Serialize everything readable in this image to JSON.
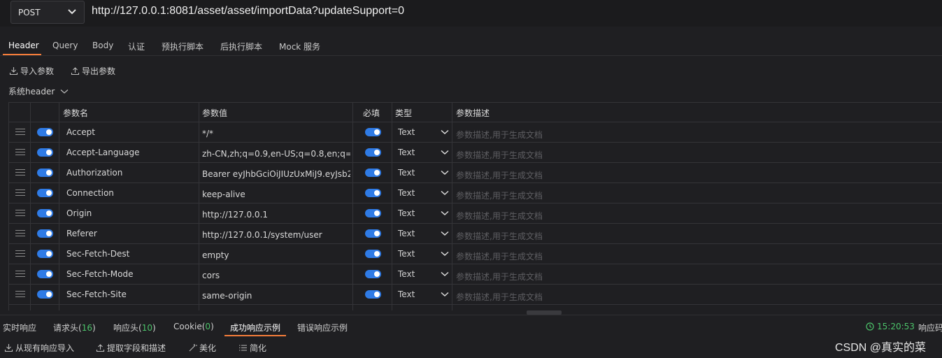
{
  "request": {
    "method": "POST",
    "url": "http://127.0.0.1:8081/asset/asset/importData?updateSupport=0"
  },
  "tabs": [
    "Header",
    "Query",
    "Body",
    "认证",
    "预执行脚本",
    "后执行脚本",
    "Mock 服务"
  ],
  "toolbar": {
    "import_label": "导入参数",
    "export_label": "导出参数",
    "system_header_label": "系统header"
  },
  "table": {
    "columns": {
      "name": "参数名",
      "value": "参数值",
      "required": "必填",
      "type": "类型",
      "description": "参数描述"
    },
    "rows": [
      {
        "name": "Accept",
        "value": "*/*",
        "type": "Text",
        "desc_placeholder": "参数描述,用于生成文档",
        "enabled": true,
        "required": true
      },
      {
        "name": "Accept-Language",
        "value": "zh-CN,zh;q=0.9,en-US;q=0.8,en;q=0.",
        "type": "Text",
        "desc_placeholder": "参数描述,用于生成文档",
        "enabled": true,
        "required": true
      },
      {
        "name": "Authorization",
        "value": "Bearer eyJhbGciOiJIUzUxMiJ9.eyJsb2",
        "type": "Text",
        "desc_placeholder": "参数描述,用于生成文档",
        "enabled": true,
        "required": true
      },
      {
        "name": "Connection",
        "value": "keep-alive",
        "type": "Text",
        "desc_placeholder": "参数描述,用于生成文档",
        "enabled": true,
        "required": true
      },
      {
        "name": "Origin",
        "value": "http://127.0.0.1",
        "type": "Text",
        "desc_placeholder": "参数描述,用于生成文档",
        "enabled": true,
        "required": true
      },
      {
        "name": "Referer",
        "value": "http://127.0.0.1/system/user",
        "type": "Text",
        "desc_placeholder": "参数描述,用于生成文档",
        "enabled": true,
        "required": true
      },
      {
        "name": "Sec-Fetch-Dest",
        "value": "empty",
        "type": "Text",
        "desc_placeholder": "参数描述,用于生成文档",
        "enabled": true,
        "required": true
      },
      {
        "name": "Sec-Fetch-Mode",
        "value": "cors",
        "type": "Text",
        "desc_placeholder": "参数描述,用于生成文档",
        "enabled": true,
        "required": true
      },
      {
        "name": "Sec-Fetch-Site",
        "value": "same-origin",
        "type": "Text",
        "desc_placeholder": "参数描述,用于生成文档",
        "enabled": true,
        "required": true
      }
    ]
  },
  "response_tabs": {
    "realtime": "实时响应",
    "req_headers": "请求头(",
    "req_headers_count": "16",
    "resp_headers": "响应头(",
    "resp_headers_count": "10",
    "cookie": "Cookie(",
    "cookie_count": "0",
    "close_paren": ")",
    "success_example": "成功响应示例",
    "error_example": "错误响应示例"
  },
  "response_meta": {
    "time": "15:20:53",
    "code_label": "响应码"
  },
  "bottom_toolbar": {
    "import_from_response": "从现有响应导入",
    "extract_fields": "提取字段和描述",
    "beautify": "美化",
    "simplify": "简化"
  },
  "watermark": "CSDN @真实的菜",
  "colors": {
    "accent": "#f57d3a",
    "toggle": "#2f7be6",
    "success": "#4cc36a",
    "background": "#1f1f22"
  }
}
